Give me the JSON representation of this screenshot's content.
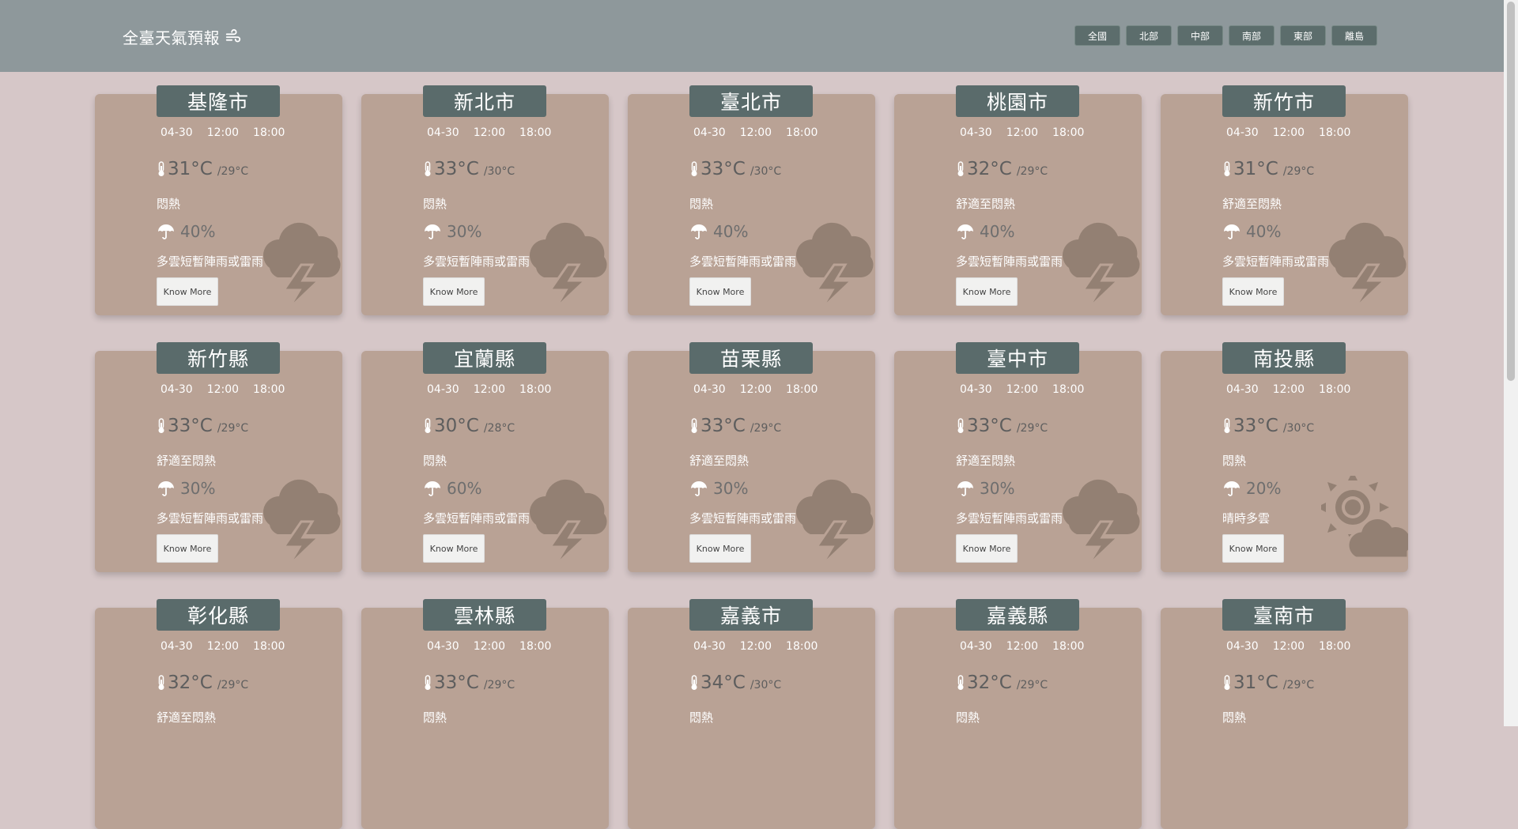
{
  "header": {
    "title": "全臺天氣預報",
    "title_icon": "wind-icon",
    "nav": [
      "全國",
      "北部",
      "中部",
      "南部",
      "東部",
      "離島"
    ]
  },
  "colors": {
    "header_bg": "#8e989b",
    "page_bg": "#d6c7c8",
    "card_bg": "#b9a295",
    "city_badge": "#5a6b6b"
  },
  "cards": [
    {
      "city": "基隆市",
      "date": "04-30",
      "t1": "12:00",
      "t2": "18:00",
      "max": "31°C",
      "min": "/29°C",
      "comfort": "悶熱",
      "pop": "40%",
      "wx": "多雲短暫陣雨或雷雨",
      "button": "Know More",
      "icon": "cloud-lightning-icon"
    },
    {
      "city": "新北市",
      "date": "04-30",
      "t1": "12:00",
      "t2": "18:00",
      "max": "33°C",
      "min": "/30°C",
      "comfort": "悶熱",
      "pop": "30%",
      "wx": "多雲短暫陣雨或雷雨",
      "button": "Know More",
      "icon": "cloud-lightning-icon"
    },
    {
      "city": "臺北市",
      "date": "04-30",
      "t1": "12:00",
      "t2": "18:00",
      "max": "33°C",
      "min": "/30°C",
      "comfort": "悶熱",
      "pop": "40%",
      "wx": "多雲短暫陣雨或雷雨",
      "button": "Know More",
      "icon": "cloud-lightning-icon"
    },
    {
      "city": "桃園市",
      "date": "04-30",
      "t1": "12:00",
      "t2": "18:00",
      "max": "32°C",
      "min": "/29°C",
      "comfort": "舒適至悶熱",
      "pop": "40%",
      "wx": "多雲短暫陣雨或雷雨",
      "button": "Know More",
      "icon": "cloud-lightning-icon"
    },
    {
      "city": "新竹市",
      "date": "04-30",
      "t1": "12:00",
      "t2": "18:00",
      "max": "31°C",
      "min": "/29°C",
      "comfort": "舒適至悶熱",
      "pop": "40%",
      "wx": "多雲短暫陣雨或雷雨",
      "button": "Know More",
      "icon": "cloud-lightning-icon"
    },
    {
      "city": "新竹縣",
      "date": "04-30",
      "t1": "12:00",
      "t2": "18:00",
      "max": "33°C",
      "min": "/29°C",
      "comfort": "舒適至悶熱",
      "pop": "30%",
      "wx": "多雲短暫陣雨或雷雨",
      "button": "Know More",
      "icon": "cloud-lightning-icon"
    },
    {
      "city": "宜蘭縣",
      "date": "04-30",
      "t1": "12:00",
      "t2": "18:00",
      "max": "30°C",
      "min": "/28°C",
      "comfort": "悶熱",
      "pop": "60%",
      "wx": "多雲短暫陣雨或雷雨",
      "button": "Know More",
      "icon": "cloud-lightning-icon"
    },
    {
      "city": "苗栗縣",
      "date": "04-30",
      "t1": "12:00",
      "t2": "18:00",
      "max": "33°C",
      "min": "/29°C",
      "comfort": "舒適至悶熱",
      "pop": "30%",
      "wx": "多雲短暫陣雨或雷雨",
      "button": "Know More",
      "icon": "cloud-lightning-icon"
    },
    {
      "city": "臺中市",
      "date": "04-30",
      "t1": "12:00",
      "t2": "18:00",
      "max": "33°C",
      "min": "/29°C",
      "comfort": "舒適至悶熱",
      "pop": "30%",
      "wx": "多雲短暫陣雨或雷雨",
      "button": "Know More",
      "icon": "cloud-lightning-icon"
    },
    {
      "city": "南投縣",
      "date": "04-30",
      "t1": "12:00",
      "t2": "18:00",
      "max": "33°C",
      "min": "/30°C",
      "comfort": "悶熱",
      "pop": "20%",
      "wx": "晴時多雲",
      "button": "Know More",
      "icon": "sun-cloud-icon"
    },
    {
      "city": "彰化縣",
      "date": "04-30",
      "t1": "12:00",
      "t2": "18:00",
      "max": "32°C",
      "min": "/29°C",
      "comfort": "舒適至悶熱",
      "pop": "",
      "wx": "",
      "button": "",
      "icon": ""
    },
    {
      "city": "雲林縣",
      "date": "04-30",
      "t1": "12:00",
      "t2": "18:00",
      "max": "33°C",
      "min": "/29°C",
      "comfort": "悶熱",
      "pop": "",
      "wx": "",
      "button": "",
      "icon": ""
    },
    {
      "city": "嘉義市",
      "date": "04-30",
      "t1": "12:00",
      "t2": "18:00",
      "max": "34°C",
      "min": "/30°C",
      "comfort": "悶熱",
      "pop": "",
      "wx": "",
      "button": "",
      "icon": ""
    },
    {
      "city": "嘉義縣",
      "date": "04-30",
      "t1": "12:00",
      "t2": "18:00",
      "max": "32°C",
      "min": "/29°C",
      "comfort": "悶熱",
      "pop": "",
      "wx": "",
      "button": "",
      "icon": ""
    },
    {
      "city": "臺南市",
      "date": "04-30",
      "t1": "12:00",
      "t2": "18:00",
      "max": "31°C",
      "min": "/29°C",
      "comfort": "悶熱",
      "pop": "",
      "wx": "",
      "button": "",
      "icon": ""
    }
  ]
}
